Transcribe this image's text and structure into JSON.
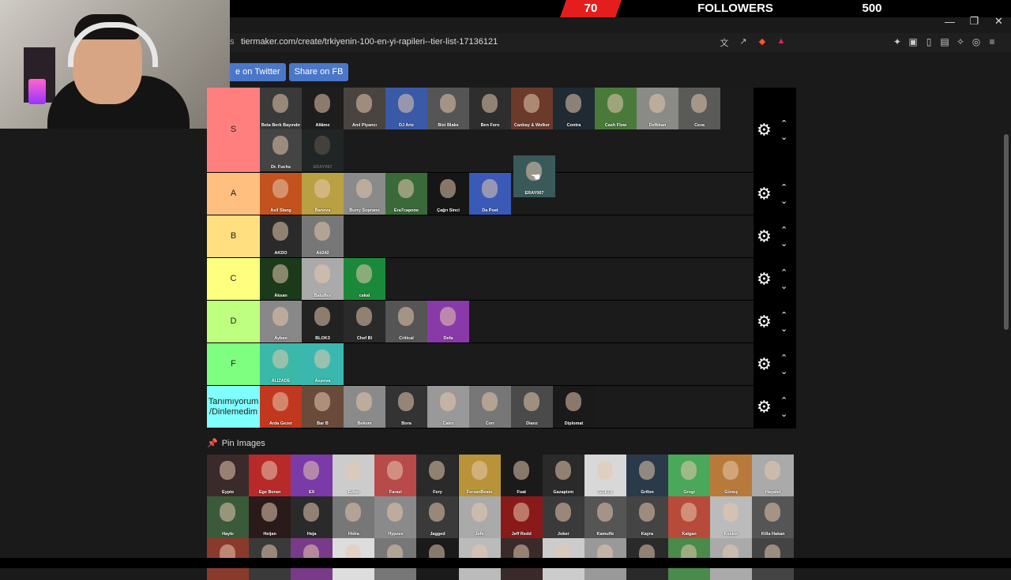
{
  "overlay": {
    "left_number": "70",
    "label": "FOLLOWERS",
    "right_number": "500"
  },
  "browser": {
    "url_prefix": "s",
    "url": "tiermaker.com/create/trkiyenin-100-en-yi-rapileri--tier-list-17136121",
    "window_controls": {
      "minimize": "—",
      "restore": "❐",
      "close": "✕"
    },
    "address_icons": [
      "translate-icon",
      "share-icon",
      "brave-shield-icon",
      "brave-rewards-icon"
    ],
    "toolbar_icons": [
      "extensions-icon",
      "tab-icon",
      "sidebar-icon",
      "wallet-icon",
      "leo-icon",
      "vpn-icon",
      "menu-icon"
    ]
  },
  "share": {
    "twitter": "e on Twitter",
    "facebook": "Share on FB"
  },
  "tiers": [
    {
      "label": "S",
      "color": "#ff7f7f",
      "height": 107,
      "items": [
        {
          "name": "Beta Berk Bayındır",
          "bg": "#3a3a3a"
        },
        {
          "name": "Allâme",
          "bg": "#1d1d1d"
        },
        {
          "name": "Anıl Piyancı",
          "bg": "#4a4440"
        },
        {
          "name": "DJ Artz",
          "bg": "#3a5aa8"
        },
        {
          "name": "Bixi Blake",
          "bg": "#555"
        },
        {
          "name": "Ben Fero",
          "bg": "#2e2e2e"
        },
        {
          "name": "Canbay & Wolker",
          "bg": "#6b3a2a"
        },
        {
          "name": "Contra",
          "bg": "#1f2a33"
        },
        {
          "name": "Cash Flow",
          "bg": "#4a7a3a"
        },
        {
          "name": "Defkhan",
          "bg": "#8a8a86"
        },
        {
          "name": "Ceza",
          "bg": "#5a5a58"
        },
        {
          "name": "Dr. Fuchs",
          "bg": "#444"
        },
        {
          "name": "ERAY067",
          "bg": "#2a3a3a",
          "ghost": true
        }
      ]
    },
    {
      "label": "A",
      "color": "#ffbf7f",
      "height": 53,
      "items": [
        {
          "name": "Asil Slang",
          "bg": "#c2531e"
        },
        {
          "name": "Baneva",
          "bg": "#b8a043"
        },
        {
          "name": "Burry Soprano",
          "bg": "#8a8a8a"
        },
        {
          "name": "Era7capone",
          "bg": "#3a6a3a"
        },
        {
          "name": "Çağrı Sinci",
          "bg": "#161616"
        },
        {
          "name": "Da Poet",
          "bg": "#3a5ab8"
        }
      ]
    },
    {
      "label": "B",
      "color": "#ffdf7f",
      "height": 53,
      "items": [
        {
          "name": "AKDO",
          "bg": "#2a2a2a"
        },
        {
          "name": "Ati242",
          "bg": "#777"
        }
      ]
    },
    {
      "label": "C",
      "color": "#ffff7f",
      "height": 53,
      "items": [
        {
          "name": "Aksan",
          "bg": "#1a3a1a"
        },
        {
          "name": "Batuflex",
          "bg": "#aaa"
        },
        {
          "name": "cakal",
          "bg": "#1a8a3a"
        }
      ]
    },
    {
      "label": "D",
      "color": "#bfff7f",
      "height": 53,
      "items": [
        {
          "name": "Ayben",
          "bg": "#888"
        },
        {
          "name": "BLOK3",
          "bg": "#222"
        },
        {
          "name": "Chef Bl",
          "bg": "#2a2a2a"
        },
        {
          "name": "Critical",
          "bg": "#555"
        },
        {
          "name": "Defa",
          "bg": "#8a3aa8"
        }
      ]
    },
    {
      "label": "F",
      "color": "#7fff7f",
      "height": 53,
      "items": [
        {
          "name": "ALIZADE",
          "bg": "#3ab8a8"
        },
        {
          "name": "Aspova",
          "bg": "#3ab8b0"
        }
      ]
    },
    {
      "label": "Tanımıyorum /Dinlemedim",
      "color": "#7fffff",
      "height": 53,
      "items": [
        {
          "name": "Arda Gezer",
          "bg": "#c2381e"
        },
        {
          "name": "Bar B",
          "bg": "#6a4a3a"
        },
        {
          "name": "Bekom",
          "bg": "#8a8a8a"
        },
        {
          "name": "Bora",
          "bg": "#333"
        },
        {
          "name": "Cairo",
          "bg": "#999"
        },
        {
          "name": "Corr",
          "bg": "#777"
        },
        {
          "name": "Dianz",
          "bg": "#4a4a4a"
        },
        {
          "name": "Diplomat",
          "bg": "#1a1a1a"
        }
      ]
    }
  ],
  "dragging": {
    "name": "ERAY067",
    "bg": "#3a5a5a"
  },
  "pin": {
    "label": "Pin Images",
    "icon": "pin-icon"
  },
  "pool": [
    {
      "name": "Eypio",
      "bg": "#3a2a2a"
    },
    {
      "name": "Ege Boran",
      "bg": "#b82a2a"
    },
    {
      "name": "EX",
      "bg": "#7a3aa8"
    },
    {
      "name": "Ezhel",
      "bg": "#ccc"
    },
    {
      "name": "Farazi",
      "bg": "#b84a4a"
    },
    {
      "name": "Fery",
      "bg": "#2a2a2a"
    },
    {
      "name": "FerzanBeats",
      "bg": "#b8933a"
    },
    {
      "name": "Fuat",
      "bg": "#1a1a1a"
    },
    {
      "name": "Gazapizm",
      "bg": "#2a2a2a"
    },
    {
      "name": "GOKO!",
      "bg": "#d8d8d8"
    },
    {
      "name": "Grifon",
      "bg": "#2a3a4a"
    },
    {
      "name": "Grogi",
      "bg": "#4aa85a"
    },
    {
      "name": "Güneş",
      "bg": "#b87a3a"
    },
    {
      "name": "Hayalet",
      "bg": "#aaa"
    },
    {
      "name": "Haykı",
      "bg": "#3a5a3a"
    },
    {
      "name": "Heijan",
      "bg": "#2a1a1a"
    },
    {
      "name": "Heja",
      "bg": "#2a2a2a"
    },
    {
      "name": "Hidra",
      "bg": "#777"
    },
    {
      "name": "Hypzex",
      "bg": "#8a8a8a"
    },
    {
      "name": "Jagged",
      "bg": "#3a3a3a"
    },
    {
      "name": "Jefe",
      "bg": "#aaa"
    },
    {
      "name": "Jeff Redd",
      "bg": "#8a1a1a"
    },
    {
      "name": "Joker",
      "bg": "#3a3a3a"
    },
    {
      "name": "Kamufle",
      "bg": "#555"
    },
    {
      "name": "Kayra",
      "bg": "#444"
    },
    {
      "name": "Kalgan",
      "bg": "#b84a3a"
    },
    {
      "name": "Keskin",
      "bg": "#bbb"
    },
    {
      "name": "Killa Hakan",
      "bg": "#555"
    },
    {
      "name": "",
      "bg": "#8a3a2a"
    },
    {
      "name": "",
      "bg": "#3a3a3a"
    },
    {
      "name": "",
      "bg": "#7a3a8a"
    },
    {
      "name": "",
      "bg": "#ddd"
    },
    {
      "name": "",
      "bg": "#777"
    },
    {
      "name": "",
      "bg": "#1a1a1a"
    },
    {
      "name": "",
      "bg": "#bbb"
    },
    {
      "name": "",
      "bg": "#3a2a2a"
    },
    {
      "name": "",
      "bg": "#ccc"
    },
    {
      "name": "",
      "bg": "#999"
    },
    {
      "name": "",
      "bg": "#2a2a2a"
    },
    {
      "name": "",
      "bg": "#4a8a4a"
    },
    {
      "name": "",
      "bg": "#aaa"
    },
    {
      "name": "",
      "bg": "#444"
    }
  ]
}
